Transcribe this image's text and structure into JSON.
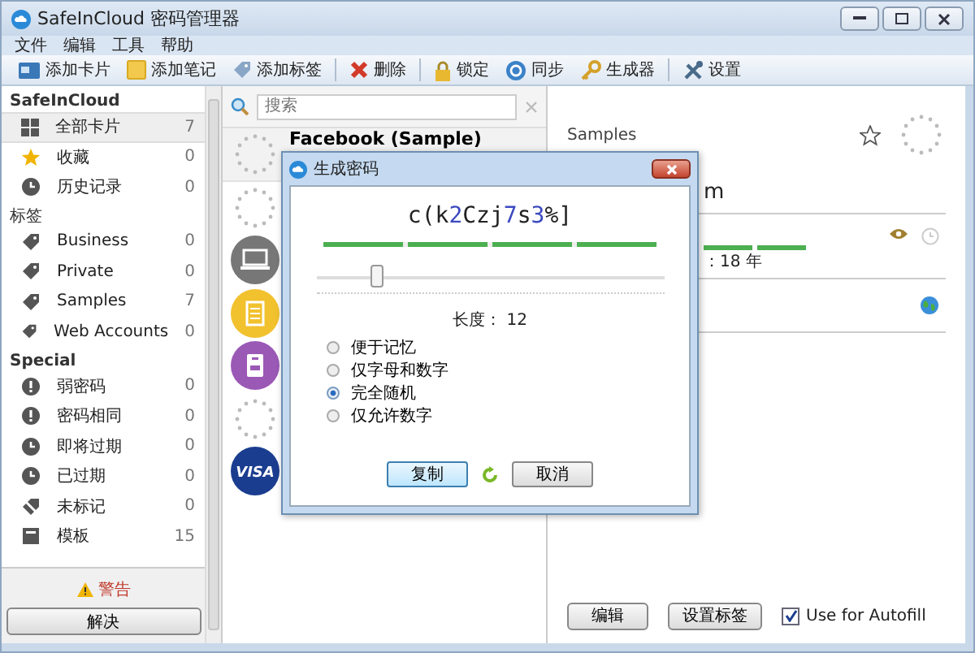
{
  "window": {
    "title": "SafeInCloud 密码管理器"
  },
  "menu": [
    "文件",
    "编辑",
    "工具",
    "帮助"
  ],
  "toolbar": [
    {
      "label": "添加卡片",
      "kind": "card",
      "separator_before": false
    },
    {
      "label": "添加笔记",
      "kind": "note",
      "separator_before": false
    },
    {
      "label": "添加标签",
      "kind": "tag",
      "separator_before": false
    },
    {
      "label": "删除",
      "kind": "delete",
      "separator_before": true
    },
    {
      "label": "锁定",
      "kind": "lock",
      "separator_before": true
    },
    {
      "label": "同步",
      "kind": "sync",
      "separator_before": false
    },
    {
      "label": "生成器",
      "kind": "key",
      "separator_before": false
    },
    {
      "label": "设置",
      "kind": "tools",
      "separator_before": true
    }
  ],
  "sidebar": {
    "sections": [
      {
        "title": "SafeInCloud",
        "items": [
          {
            "label": "全部卡片",
            "count": "7",
            "kind": "grid",
            "selected": true
          },
          {
            "label": "收藏",
            "count": "0",
            "kind": "star",
            "selected": false
          },
          {
            "label": "历史记录",
            "count": "0",
            "kind": "clock",
            "selected": false
          }
        ]
      },
      {
        "title": "标签",
        "items": [
          {
            "label": "Business",
            "count": "0",
            "kind": "tag",
            "selected": false
          },
          {
            "label": "Private",
            "count": "0",
            "kind": "tag",
            "selected": false
          },
          {
            "label": "Samples",
            "count": "7",
            "kind": "tag",
            "selected": false
          },
          {
            "label": "Web Accounts",
            "count": "0",
            "kind": "tag",
            "selected": false
          }
        ]
      },
      {
        "title": "Special",
        "items": [
          {
            "label": "弱密码",
            "count": "0",
            "kind": "alert",
            "selected": false
          },
          {
            "label": "密码相同",
            "count": "0",
            "kind": "alert",
            "selected": false
          },
          {
            "label": "即将过期",
            "count": "0",
            "kind": "clock",
            "selected": false
          },
          {
            "label": "已过期",
            "count": "0",
            "kind": "clock",
            "selected": false
          },
          {
            "label": "未标记",
            "count": "0",
            "kind": "untag",
            "selected": false
          },
          {
            "label": "模板",
            "count": "15",
            "kind": "template",
            "selected": false
          }
        ]
      }
    ],
    "warning": "警告",
    "resolve_button": "解决"
  },
  "search": {
    "placeholder": "搜索"
  },
  "cards": [
    {
      "title": "Facebook (Sample)",
      "kind": "loading",
      "selected": true
    },
    {
      "kind": "loading",
      "selected": false
    },
    {
      "kind": "laptop",
      "selected": false
    },
    {
      "kind": "note",
      "selected": false
    },
    {
      "kind": "badge",
      "selected": false
    },
    {
      "kind": "loading",
      "selected": false
    },
    {
      "kind": "visa",
      "logo_text": "VISA",
      "selected": false
    }
  ],
  "detail": {
    "tag": "Samples",
    "favorite": false,
    "fields": [
      {
        "kind": "text",
        "value": "m"
      },
      {
        "kind": "password",
        "value": "：18 年"
      },
      {
        "kind": "url"
      }
    ],
    "edit_button": "编辑",
    "tags_button": "设置标签",
    "autofill": {
      "label": "Use for Autofill",
      "checked": true
    }
  },
  "dialog": {
    "title": "生成密码",
    "password": "c(k2Czj7s3%]",
    "strength": {
      "level": 1
    },
    "length_slider": {
      "level": 0.17
    },
    "length_label": "长度： 12",
    "options": [
      {
        "label": "便于记忆",
        "selected": false
      },
      {
        "label": "仅字母和数字",
        "selected": false
      },
      {
        "label": "完全随机",
        "selected": true
      },
      {
        "label": "仅允许数字",
        "selected": false
      }
    ],
    "copy_button": "复制",
    "cancel_button": "取消"
  }
}
